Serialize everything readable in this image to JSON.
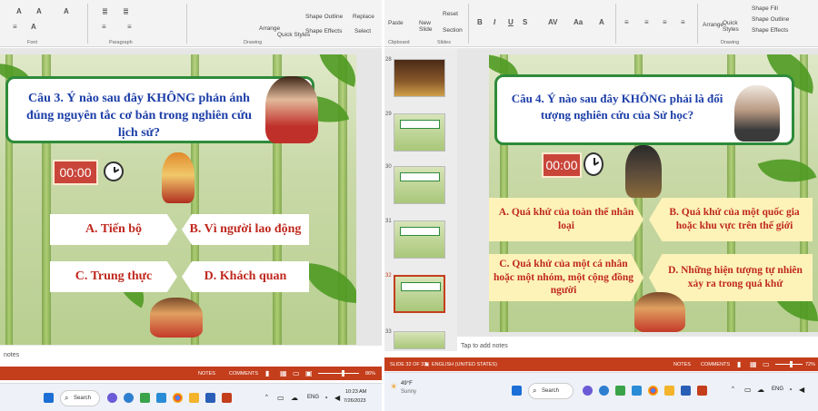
{
  "left": {
    "ribbon": {
      "groups": [
        "Font",
        "Paragraph",
        "Drawing"
      ],
      "buttons": [
        "Arrange",
        "Quick Styles",
        "Shape Outline",
        "Shape Effects",
        "Replace",
        "Select"
      ]
    },
    "slide": {
      "question": "Câu 3. Ý nào sau đây KHÔNG phản ánh đúng nguyên tắc cơ bản trong nghiên cứu lịch sử?",
      "timer": "00:00",
      "answers": [
        "A. Tiến bộ",
        "B. Vì người lao động",
        "C. Trung thực",
        "D. Khách quan"
      ]
    },
    "notes": "notes",
    "status": {
      "notes": "NOTES",
      "comments": "COMMENTS",
      "zoom": "86%"
    },
    "taskbar": {
      "search": "Search",
      "lang": "ENG",
      "time": "10:23 AM",
      "date": "7/26/2023"
    }
  },
  "right": {
    "ribbon": {
      "groups": [
        "Clipboard",
        "Slides",
        "Drawing"
      ],
      "buttons": [
        "Paste",
        "New Slide",
        "Reset",
        "Section",
        "Arrange",
        "Quick Styles",
        "Shape Fill",
        "Shape Outline",
        "Shape Effects"
      ]
    },
    "thumbnails": [
      "28",
      "29",
      "30",
      "31",
      "32",
      "33"
    ],
    "slide": {
      "question": "Câu 4. Ý nào sau đây KHÔNG phải là đối tượng nghiên cứu của Sử học?",
      "timer": "00:00",
      "answers": [
        "A. Quá khứ của toàn thể nhân loại",
        "B. Quá khứ của một quốc gia hoặc khu vực trên thế giới",
        "C. Quá khứ của một cá nhân hoặc một nhóm, một cộng đồng người",
        "D. Những hiện tượng tự nhiên xảy ra trong quá khứ"
      ]
    },
    "notes": "Tap to add notes",
    "status": {
      "slide": "SLIDE 32 OF 37",
      "lang": "ENGLISH (UNITED STATES)",
      "notes": "NOTES",
      "comments": "COMMENTS",
      "zoom": "72%"
    },
    "taskbar": {
      "weather_temp": "49°F",
      "weather_desc": "Sunny",
      "search": "Search",
      "lang": "ENG"
    }
  },
  "colors": {
    "statusbar": "#c43e1c",
    "question_text": "#1c3ea8",
    "answer_text": "#c0281e",
    "timer": "#c9453a"
  },
  "icons": [
    "windows-icon",
    "search-icon",
    "chrome-icon",
    "edge-icon",
    "word-icon",
    "powerpoint-icon",
    "clock-icon",
    "wifi-icon",
    "volume-icon",
    "battery-icon"
  ]
}
